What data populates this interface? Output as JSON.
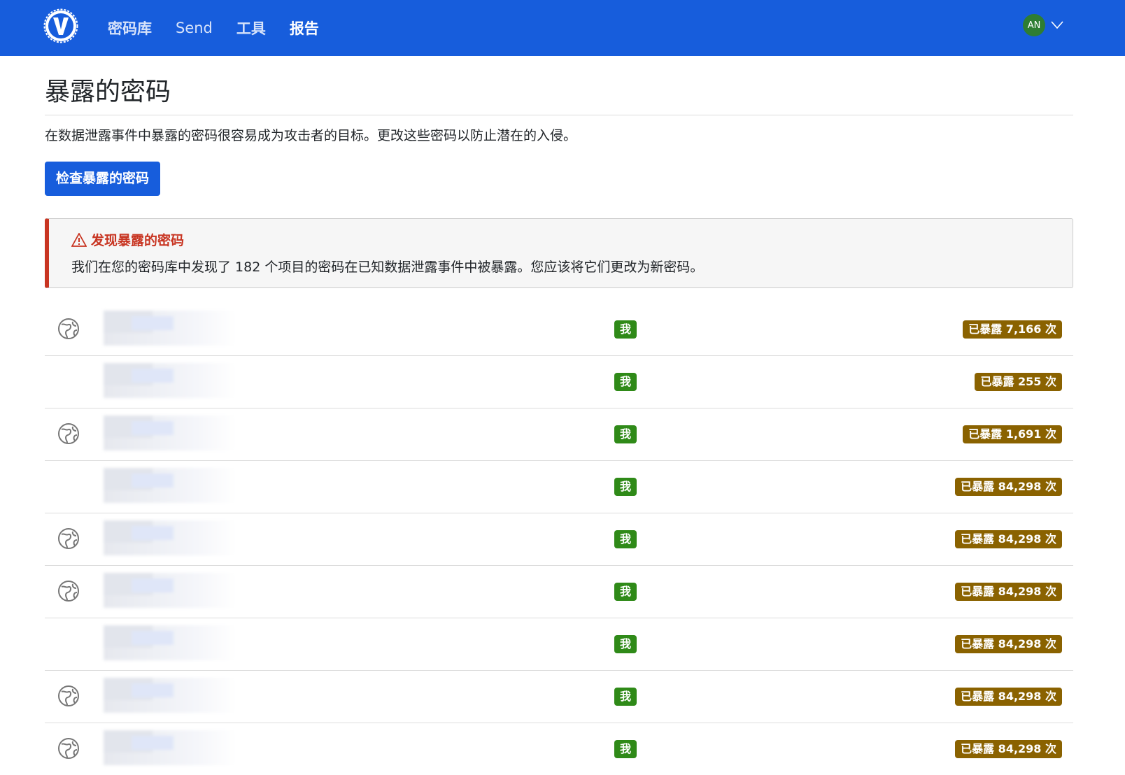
{
  "nav": {
    "items": [
      {
        "label": "密码库",
        "active": false
      },
      {
        "label": "Send",
        "active": false
      },
      {
        "label": "工具",
        "active": false
      },
      {
        "label": "报告",
        "active": true
      }
    ],
    "avatar_initials": "AN"
  },
  "page": {
    "title": "暴露的密码",
    "description": "在数据泄露事件中暴露的密码很容易成为攻击者的目标。更改这些密码以防止潜在的入侵。",
    "check_button": "检查暴露的密码"
  },
  "alert": {
    "title": "发现暴露的密码",
    "body": "我们在您的密码库中发现了 182 个项目的密码在已知数据泄露事件中被暴露。您应该将它们更改为新密码。"
  },
  "rows": [
    {
      "has_icon": true,
      "owner": "我",
      "exposed": "已暴露 7,166 次"
    },
    {
      "has_icon": false,
      "owner": "我",
      "exposed": "已暴露 255 次"
    },
    {
      "has_icon": true,
      "owner": "我",
      "exposed": "已暴露 1,691 次"
    },
    {
      "has_icon": false,
      "owner": "我",
      "exposed": "已暴露 84,298 次"
    },
    {
      "has_icon": true,
      "owner": "我",
      "exposed": "已暴露 84,298 次"
    },
    {
      "has_icon": true,
      "owner": "我",
      "exposed": "已暴露 84,298 次"
    },
    {
      "has_icon": false,
      "owner": "我",
      "exposed": "已暴露 84,298 次"
    },
    {
      "has_icon": true,
      "owner": "我",
      "exposed": "已暴露 84,298 次"
    },
    {
      "has_icon": true,
      "owner": "我",
      "exposed": "已暴露 84,298 次"
    }
  ],
  "colors": {
    "brand": "#175ddc",
    "danger": "#c83522",
    "owner_badge": "#2f8a18",
    "exposed_badge": "#8a6200"
  },
  "icons": {
    "logo": "vaultwarden-logo",
    "row": "globe-icon",
    "alert": "warning-icon",
    "caret": "chevron-down-icon"
  }
}
